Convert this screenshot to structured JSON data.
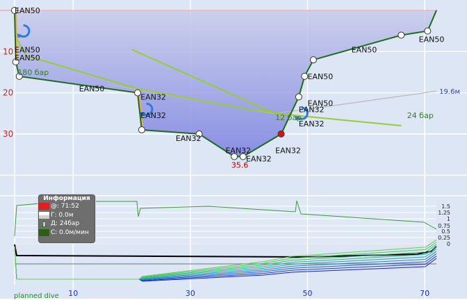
{
  "chart_data": {
    "type": "line",
    "xlabel": "",
    "ylabel": "",
    "x_ticks": [
      10,
      30,
      50,
      70
    ],
    "y_ticks": [
      10,
      20,
      30
    ],
    "xlim": [
      -2,
      74
    ],
    "ylim_depth": [
      -1.5,
      47
    ],
    "series": [
      {
        "role": "dive_profile",
        "x": [
          0,
          0.2,
          0.8,
          21,
          21.7,
          31.5,
          37.5,
          39,
          45.5,
          48.5,
          49.5,
          51,
          66,
          70.5,
          72
        ],
        "y": [
          0,
          12.5,
          16,
          20,
          29,
          30,
          35.5,
          35.5,
          30,
          21,
          16,
          12,
          6,
          5,
          0
        ]
      },
      {
        "role": "gas_pressure_EAN50",
        "x": [
          0,
          2,
          21,
          40,
          48,
          66
        ],
        "y": [
          6,
          11,
          19,
          24,
          25.5,
          28
        ]
      },
      {
        "role": "gas_pressure_EAN32",
        "x": [
          20,
          35,
          46
        ],
        "y": [
          9.5,
          19,
          26
        ]
      },
      {
        "role": "ceiling_line",
        "x": [
          16,
          44,
          50,
          72
        ],
        "y": [
          18,
          25,
          24,
          19.6
        ]
      }
    ],
    "gas_labels": [
      {
        "x": 0,
        "y": 0,
        "text": "EAN50"
      },
      {
        "x": 0,
        "y": 9.5,
        "text": "EAN50"
      },
      {
        "x": 0,
        "y": 11.5,
        "text": "EAN50"
      },
      {
        "x": 11,
        "y": 19,
        "text": "EAN50"
      },
      {
        "x": 21.5,
        "y": 21,
        "text": "EAN32"
      },
      {
        "x": 21.5,
        "y": 25.5,
        "text": "EAN32"
      },
      {
        "x": 27.5,
        "y": 31,
        "text": "EAN32"
      },
      {
        "x": 36,
        "y": 34,
        "text": "EAN32"
      },
      {
        "x": 39.5,
        "y": 36,
        "text": "EAN32"
      },
      {
        "x": 44.5,
        "y": 34,
        "text": "EAN32"
      },
      {
        "x": 48.5,
        "y": 24,
        "text": "EAN32"
      },
      {
        "x": 48.5,
        "y": 27.5,
        "text": "EAN32"
      },
      {
        "x": 50,
        "y": 22.5,
        "text": "EAN50"
      },
      {
        "x": 50,
        "y": 16,
        "text": "EAN50"
      },
      {
        "x": 57.5,
        "y": 9.5,
        "text": "EAN50"
      },
      {
        "x": 69,
        "y": 7,
        "text": "EAN50"
      }
    ],
    "annotations": [
      {
        "x": 0.5,
        "y": 15,
        "text": "180 бар"
      },
      {
        "x": 44.5,
        "y": 26,
        "text": "12 бар"
      },
      {
        "x": 67,
        "y": 25.5,
        "text": "24 бар"
      },
      {
        "x": 72.5,
        "y": 19.6,
        "text": "19.6м"
      },
      {
        "x": 37,
        "y": 37.5,
        "text": "35.6"
      }
    ],
    "ppo2_axis_ticks": [
      "1.5",
      "1.25",
      "1",
      "0.75",
      "0.5",
      "0.25",
      "0"
    ]
  },
  "info_panel": {
    "title": "Информация",
    "rows": [
      {
        "icon": "clock-flag-icon",
        "text": "@: 71:52"
      },
      {
        "icon": "depth-flag-icon",
        "text": "Г: 0.0м"
      },
      {
        "icon": "pressure-tank-icon",
        "text": "Д: 24бар"
      },
      {
        "icon": "speed-flag-icon",
        "text": "С: 0.0м/мин"
      }
    ]
  },
  "footer": {
    "label": "planned dive"
  },
  "colors": {
    "background": "#dce6f4",
    "profile_line": "#1f6b1f",
    "gas_line": "#99cc33",
    "ceiling_line": "#bcbcbc",
    "fill_top": "#c8ccea",
    "fill_bottom": "#7a7fe0",
    "depth_tick_label": "#d02020",
    "time_tick_label": "#1a2fbf",
    "max_depth_label": "#b00000"
  }
}
